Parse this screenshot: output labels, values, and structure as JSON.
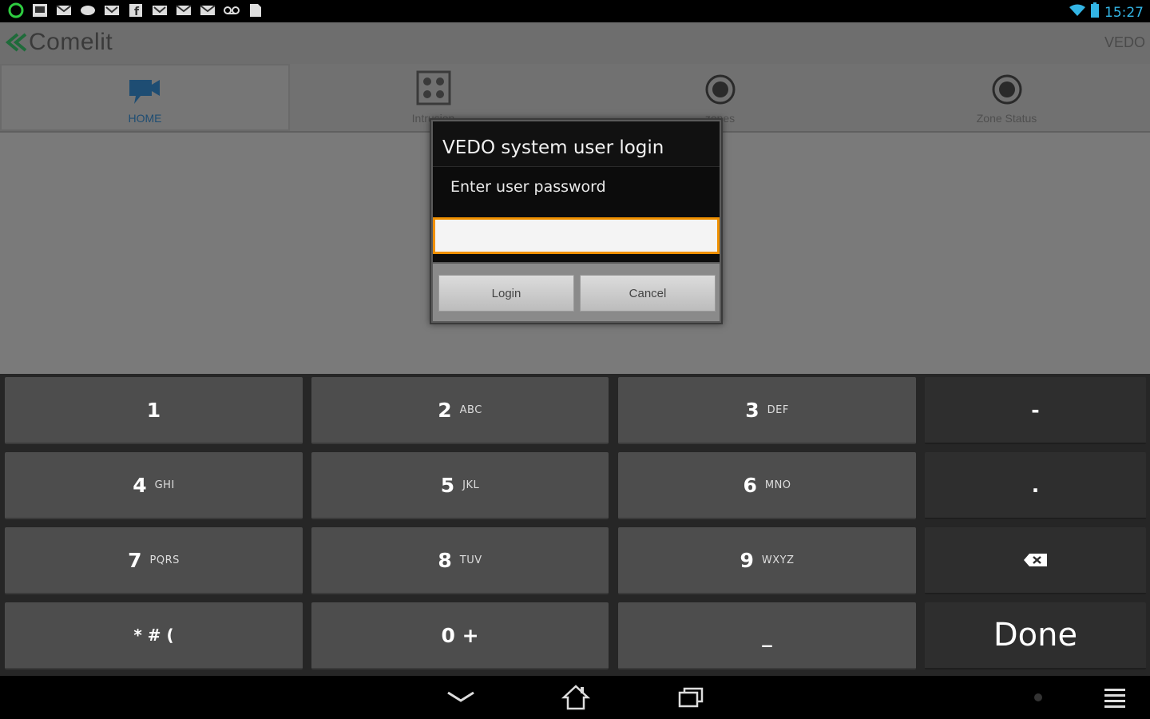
{
  "status_bar": {
    "time": "15:27",
    "notification_icons": [
      "app-icon",
      "gallery-icon",
      "mail-icon",
      "chat-icon",
      "gmail-icon",
      "facebook-icon",
      "gmail-icon",
      "mail-icon",
      "mail-icon",
      "voicemail-icon",
      "document-icon"
    ]
  },
  "header": {
    "logo_text": "Comelit",
    "right_label": "VEDO"
  },
  "tabs": [
    {
      "label": "HOME",
      "icon": "video-camera-icon",
      "active": true
    },
    {
      "label": "Intrusion",
      "icon": "grid-icon",
      "active": false
    },
    {
      "label": "zones",
      "icon": "radio-icon",
      "active": false
    },
    {
      "label": "Zone Status",
      "icon": "target-icon",
      "active": false
    }
  ],
  "dialog": {
    "title": "VEDO system user login",
    "message": "Enter user password",
    "password_value": "",
    "login_label": "Login",
    "cancel_label": "Cancel"
  },
  "keyboard": {
    "keys": [
      {
        "main": "1",
        "sub": ""
      },
      {
        "main": "2",
        "sub": "ABC"
      },
      {
        "main": "3",
        "sub": "DEF"
      },
      {
        "main": "-",
        "sub": ""
      },
      {
        "main": "4",
        "sub": "GHI"
      },
      {
        "main": "5",
        "sub": "JKL"
      },
      {
        "main": "6",
        "sub": "MNO"
      },
      {
        "main": ".",
        "sub": ""
      },
      {
        "main": "7",
        "sub": "PQRS"
      },
      {
        "main": "8",
        "sub": "TUV"
      },
      {
        "main": "9",
        "sub": "WXYZ"
      },
      {
        "main": "",
        "sub": ""
      },
      {
        "main": "* # (",
        "sub": ""
      },
      {
        "main": "0 +",
        "sub": ""
      },
      {
        "main": "_",
        "sub": ""
      },
      {
        "main": "Done",
        "sub": ""
      }
    ]
  },
  "colors": {
    "accent": "#33b5e5",
    "input_focus": "#f09000",
    "active_tab": "#1e4d73"
  }
}
